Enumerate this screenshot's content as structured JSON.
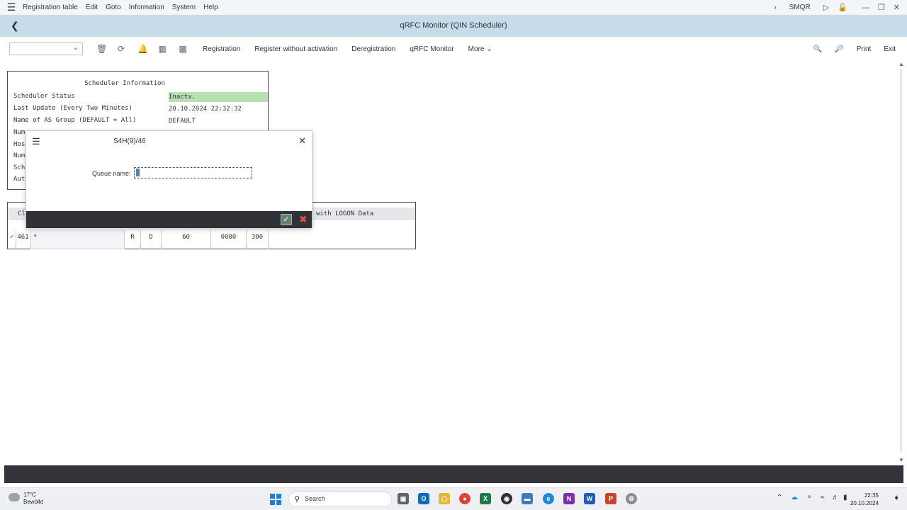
{
  "menubar": {
    "items": [
      "Registration table",
      "Edit",
      "Goto",
      "Information",
      "System",
      "Help"
    ],
    "tcode": "SMQR"
  },
  "titlebar": {
    "title": "qRFC Monitor (QIN Scheduler)"
  },
  "toolbar": {
    "buttons": [
      "Registration",
      "Register without activation",
      "Deregistration",
      "qRFC Monitor",
      "More"
    ],
    "right_buttons": [
      "Print",
      "Exit"
    ]
  },
  "scheduler_info": {
    "title": "Scheduler Information",
    "rows": [
      {
        "label": "Scheduler Status",
        "value": "Inactv."
      },
      {
        "label": "Last Update (Every Two Minutes)",
        "value": "20.10.2024 22:32:32"
      },
      {
        "label": "Name of AS Group (DEFAULT = All)",
        "value": "DEFAULT"
      },
      {
        "label": "Num",
        "value": ""
      },
      {
        "label": "Hos",
        "value": ""
      },
      {
        "label": "Num",
        "value": ""
      },
      {
        "label": "Sch",
        "value": ""
      },
      {
        "label": "Aut",
        "value": ""
      }
    ]
  },
  "registration_table": {
    "header_left": "Cl",
    "header_right": "with LOGON Data",
    "row": {
      "client": "461",
      "queue": "*",
      "mode": "R",
      "type": "D",
      "max_time": "60",
      "delay": "0000",
      "runs": "300"
    }
  },
  "dialog": {
    "title": "S4H(9)/46",
    "queue_label": "Queue name:",
    "queue_value": ""
  },
  "taskbar": {
    "temperature": "17°C",
    "weather": "Bewölkt",
    "search_label": "Search",
    "time": "22:35",
    "date": "20.10.2024"
  }
}
